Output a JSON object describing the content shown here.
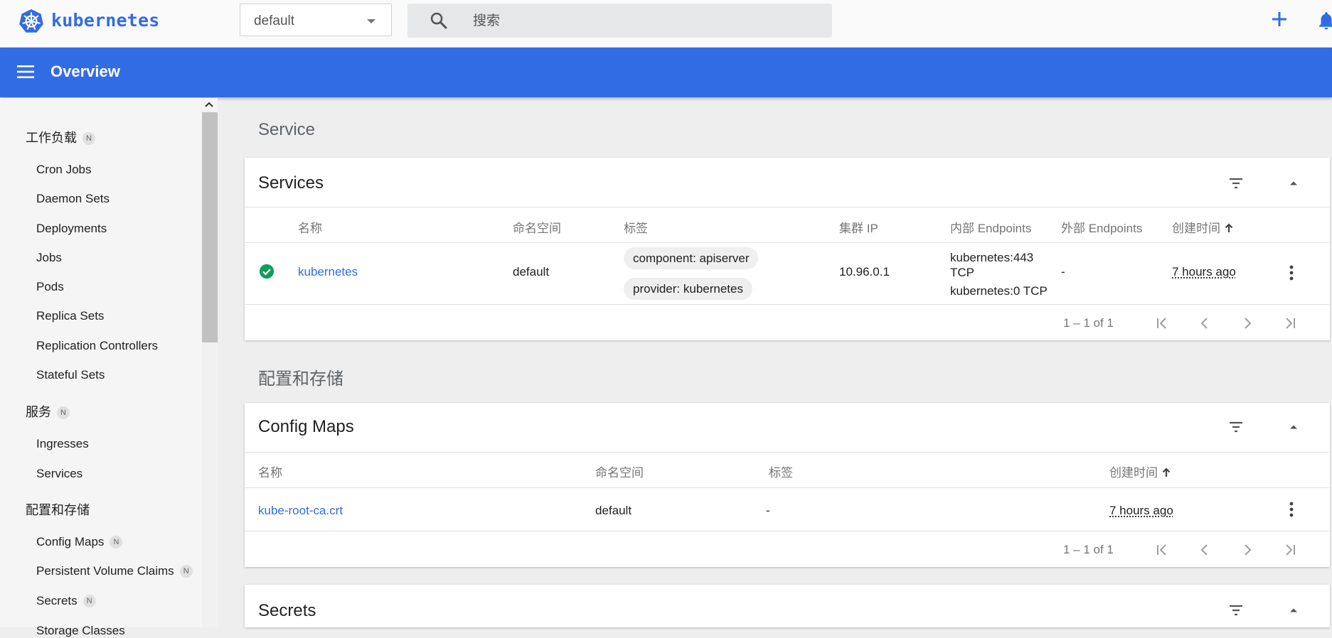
{
  "header": {
    "brand": "kubernetes",
    "namespace": "default",
    "search_placeholder": "搜索",
    "icons": [
      "kubernetes-logo",
      "search-icon",
      "plus-icon",
      "bell-icon"
    ]
  },
  "toolbar": {
    "title": "Overview"
  },
  "sidebar": {
    "sections": [
      {
        "label": "工作负载",
        "badge": "N",
        "items": [
          {
            "label": "Cron Jobs"
          },
          {
            "label": "Daemon Sets"
          },
          {
            "label": "Deployments"
          },
          {
            "label": "Jobs"
          },
          {
            "label": "Pods"
          },
          {
            "label": "Replica Sets"
          },
          {
            "label": "Replication Controllers"
          },
          {
            "label": "Stateful Sets"
          }
        ]
      },
      {
        "label": "服务",
        "badge": "N",
        "items": [
          {
            "label": "Ingresses"
          },
          {
            "label": "Services"
          }
        ]
      },
      {
        "label": "配置和存储",
        "items": [
          {
            "label": "Config Maps",
            "badge": "N"
          },
          {
            "label": "Persistent Volume Claims",
            "badge": "N"
          },
          {
            "label": "Secrets",
            "badge": "N"
          },
          {
            "label": "Storage Classes"
          }
        ]
      }
    ]
  },
  "main": {
    "service_section": "Service",
    "services": {
      "title": "Services",
      "columns": [
        "名称",
        "命名空间",
        "标签",
        "集群 IP",
        "内部 Endpoints",
        "外部 Endpoints",
        "创建时间"
      ],
      "rows": [
        {
          "status": "ok",
          "name": "kubernetes",
          "namespace": "default",
          "labels": [
            "component: apiserver",
            "provider: kubernetes"
          ],
          "cluster_ip": "10.96.0.1",
          "internal_endpoints": [
            "kubernetes:443 TCP",
            "kubernetes:0 TCP"
          ],
          "external_endpoints": "-",
          "created": "7 hours ago"
        }
      ],
      "pagination": "1 – 1 of 1"
    },
    "config_section": "配置和存储",
    "config_maps": {
      "title": "Config Maps",
      "columns": [
        "名称",
        "命名空间",
        "标签",
        "创建时间"
      ],
      "rows": [
        {
          "name": "kube-root-ca.crt",
          "namespace": "default",
          "labels": "-",
          "created": "7 hours ago"
        }
      ],
      "pagination": "1 – 1 of 1"
    },
    "secrets": {
      "title": "Secrets"
    }
  },
  "colors": {
    "primary": "#326ce5",
    "success": "#0f9d58",
    "background": "#eeeeee"
  }
}
